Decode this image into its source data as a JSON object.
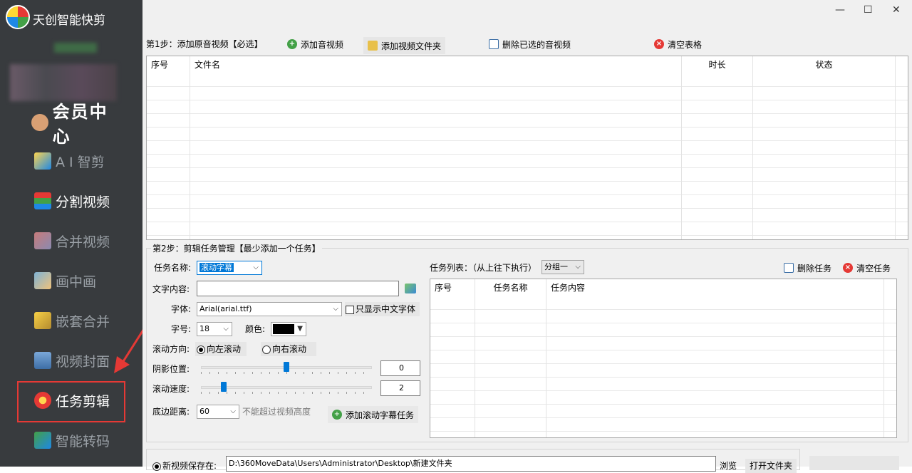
{
  "app": {
    "title": "天创智能快剪"
  },
  "window": {
    "minimize": "—",
    "maximize": "☐",
    "close": "✕"
  },
  "sidebar": {
    "member": "会员中心",
    "items": [
      {
        "label": "A I 智剪"
      },
      {
        "label": "分割视频"
      },
      {
        "label": "合并视频"
      },
      {
        "label": "画中画"
      },
      {
        "label": "嵌套合并"
      },
      {
        "label": "视频封面"
      },
      {
        "label": "任务剪辑"
      },
      {
        "label": "智能转码"
      }
    ]
  },
  "step1": {
    "title": "第1步：添加原音视频【必选】",
    "add_av": "添加音视频",
    "add_folder": "添加视频文件夹",
    "delete_selected": "删除已选的音视频",
    "clear_table": "清空表格",
    "columns": [
      "序号",
      "文件名",
      "时长",
      "状态"
    ]
  },
  "step2": {
    "title": "第2步：剪辑任务管理【最少添加一个任务】",
    "task_name_label": "任务名称:",
    "task_name_value": "滚动字幕",
    "text_content_label": "文字内容:",
    "text_content_value": "",
    "font_label": "字体:",
    "font_value": "Arial(arial.ttf)",
    "only_chinese": "只显示中文字体",
    "size_label": "字号:",
    "size_value": "18",
    "color_label": "颜色:",
    "color_value": "#000000",
    "direction_label": "滚动方向:",
    "dir_left": "向左滚动",
    "dir_right": "向右滚动",
    "shadow_label": "阴影位置:",
    "shadow_value": "0",
    "shadow_level": 0.5,
    "speed_label": "滚动速度:",
    "speed_value": "2",
    "speed_level": 0.12,
    "bottom_label": "底边距离:",
    "bottom_value": "60",
    "bottom_hint": "不能超过视频高度",
    "add_task": "添加滚动字幕任务"
  },
  "tasklist": {
    "label": "任务列表：（从上往下执行）",
    "group_value": "分组一",
    "delete_task": "删除任务",
    "clear_tasks": "清空任务",
    "columns": [
      "序号",
      "任务名称",
      "任务内容"
    ]
  },
  "output": {
    "save_label": "新视频保存在:",
    "path": "D:\\360MoveData\\Users\\Administrator\\Desktop\\新建文件夹",
    "browse": "浏览",
    "open_folder": "打开文件夹"
  }
}
